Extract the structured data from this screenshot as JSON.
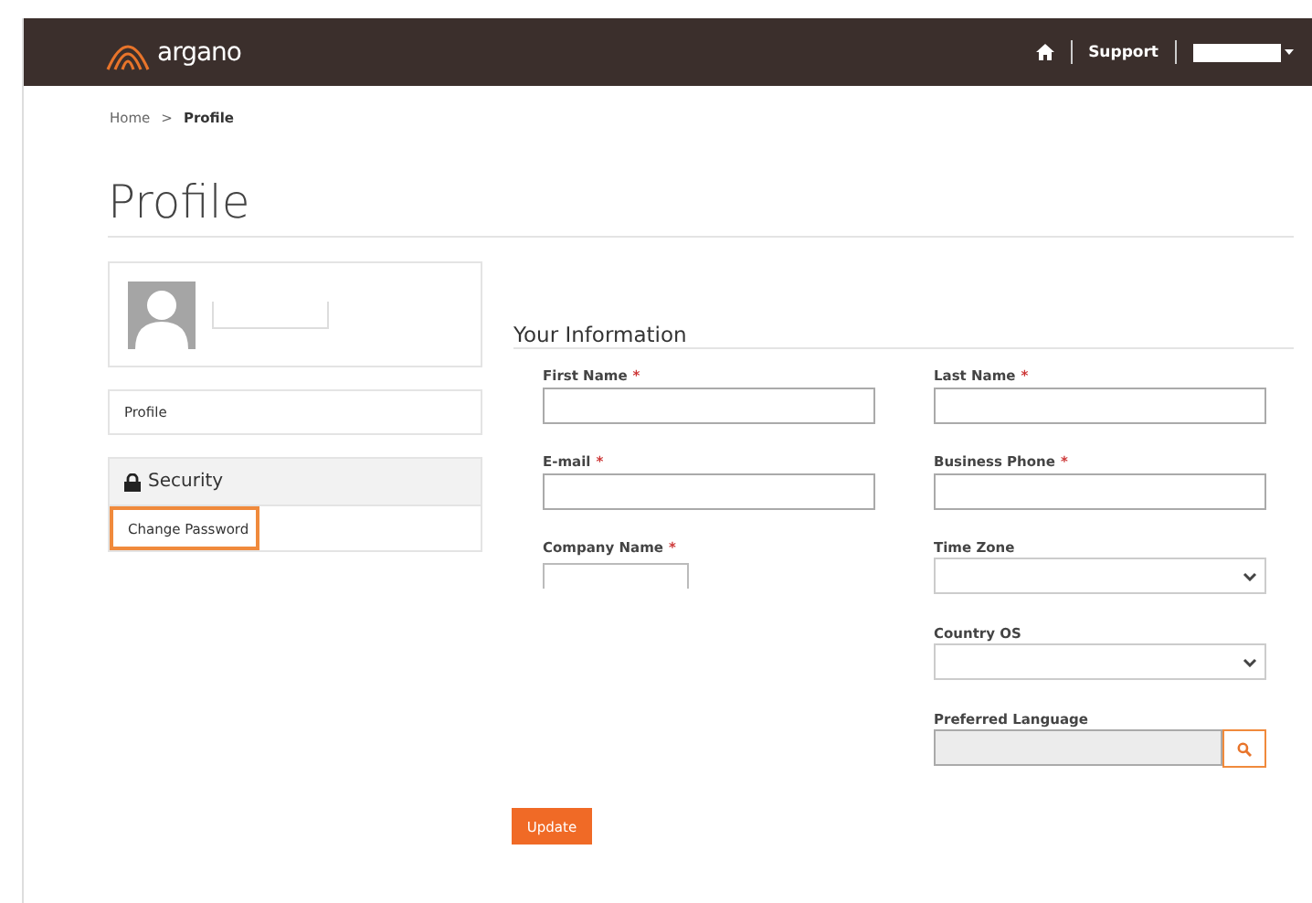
{
  "header": {
    "logo_text": "argano",
    "support": "Support"
  },
  "breadcrumb": {
    "separator": ">",
    "items": [
      {
        "label": "Home",
        "current": false
      },
      {
        "label": "Profile",
        "current": true
      }
    ]
  },
  "title": "Profile",
  "sidebar": {
    "profile_link": "Profile",
    "security": {
      "title": "Security",
      "items": [
        {
          "label": "Change Password",
          "selected": true
        }
      ]
    }
  },
  "form": {
    "title": "Your Information",
    "required_mark": "*",
    "columns": [
      [
        {
          "label": "First Name",
          "required": true,
          "kind": "text",
          "disabled": false
        },
        {
          "label": "E-mail",
          "required": true,
          "kind": "text",
          "disabled": false
        },
        {
          "label": "Company Name",
          "required": true,
          "kind": "partial",
          "disabled": false
        }
      ],
      [
        {
          "label": "Last Name",
          "required": true,
          "kind": "text",
          "disabled": false
        },
        {
          "label": "Business Phone",
          "required": true,
          "kind": "text",
          "disabled": false
        },
        {
          "label": "Time Zone",
          "required": false,
          "kind": "select",
          "disabled": false
        },
        {
          "label": "Country OS",
          "required": false,
          "kind": "select",
          "disabled": false
        },
        {
          "label": "Preferred Language",
          "required": false,
          "kind": "lookup",
          "disabled": true
        }
      ]
    ]
  },
  "update_button": "Update"
}
